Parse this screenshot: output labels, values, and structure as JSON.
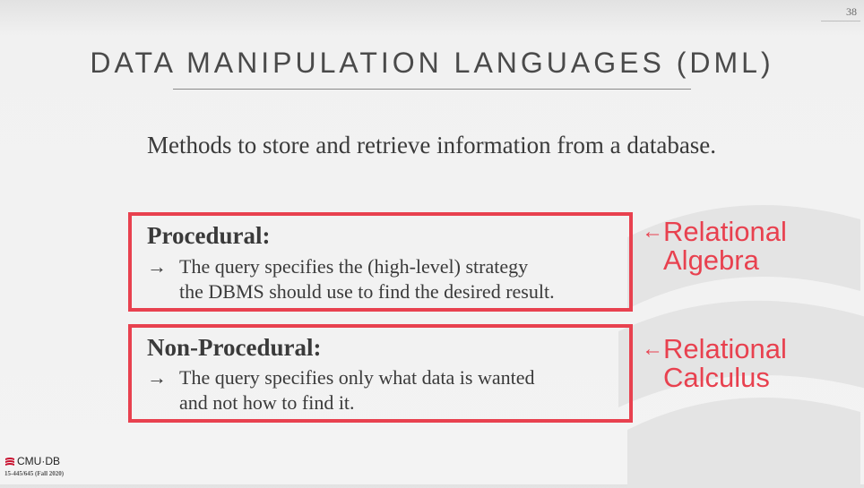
{
  "slide": {
    "number": "38",
    "title": "DATA MANIPULATION LANGUAGES (DML)",
    "intro": "Methods to store and retrieve information from a database."
  },
  "procedural": {
    "heading": "Procedural:",
    "arrow": "→",
    "line1": "The query specifies the (high-level) strategy",
    "line2": "the DBMS should use to find the desired result.",
    "annotation_arrow": "←",
    "annotation_line1": "Relational",
    "annotation_line2": "Algebra"
  },
  "nonprocedural": {
    "heading": "Non-Procedural:",
    "arrow": "→",
    "line1": "The query specifies only what data is wanted",
    "line2": "and not how to find it.",
    "annotation_arrow": "←",
    "annotation_line1": "Relational",
    "annotation_line2": "Calculus"
  },
  "footer": {
    "logo_text": "CMU·DB",
    "course_code": "15-445/645 (Fall 2020)"
  },
  "colors": {
    "accent": "#e8414f",
    "text": "#3a3a3a",
    "logo_red": "#c8102e"
  }
}
